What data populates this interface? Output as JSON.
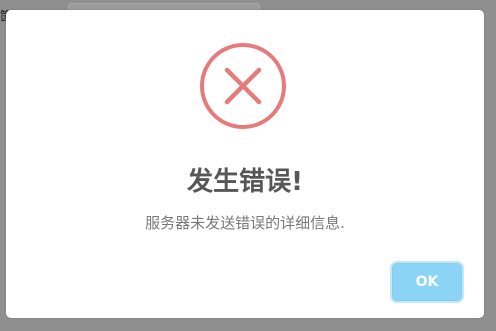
{
  "background": {
    "partial_text": "筃"
  },
  "dialog": {
    "icon": "error-x-circle-icon",
    "title": "发生错误!",
    "message": "服务器未发送错误的详细信息.",
    "ok_label": "OK"
  },
  "colors": {
    "icon": "#e77b7b",
    "ok_button": "#8cd4f5",
    "overlay": "#8f8f8f"
  }
}
